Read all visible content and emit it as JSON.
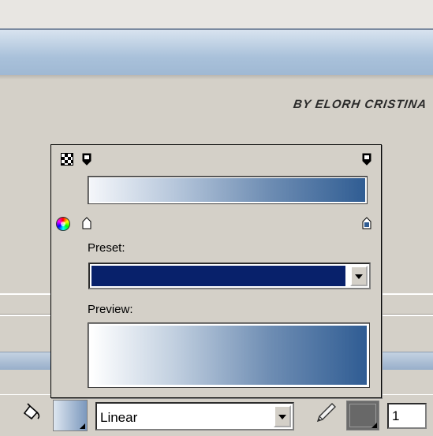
{
  "credit": {
    "text": "BY ELORH CRISTINA"
  },
  "gradient_panel": {
    "preset_label": "Preset:",
    "preview_label": "Preview:",
    "preset_color": "#08216b",
    "gradient_colors": [
      "#f4f6fa",
      "#b8c8dc",
      "#6e8db3",
      "#305d93"
    ]
  },
  "toolbar": {
    "fill_type_value": "Linear",
    "stroke_width_value": "1",
    "stroke_color": "#6b6b6b"
  },
  "icons": [
    "alpha-checker-icon",
    "color-wheel-icon",
    "paint-bucket-icon",
    "pencil-icon",
    "chevron-down-icon"
  ]
}
